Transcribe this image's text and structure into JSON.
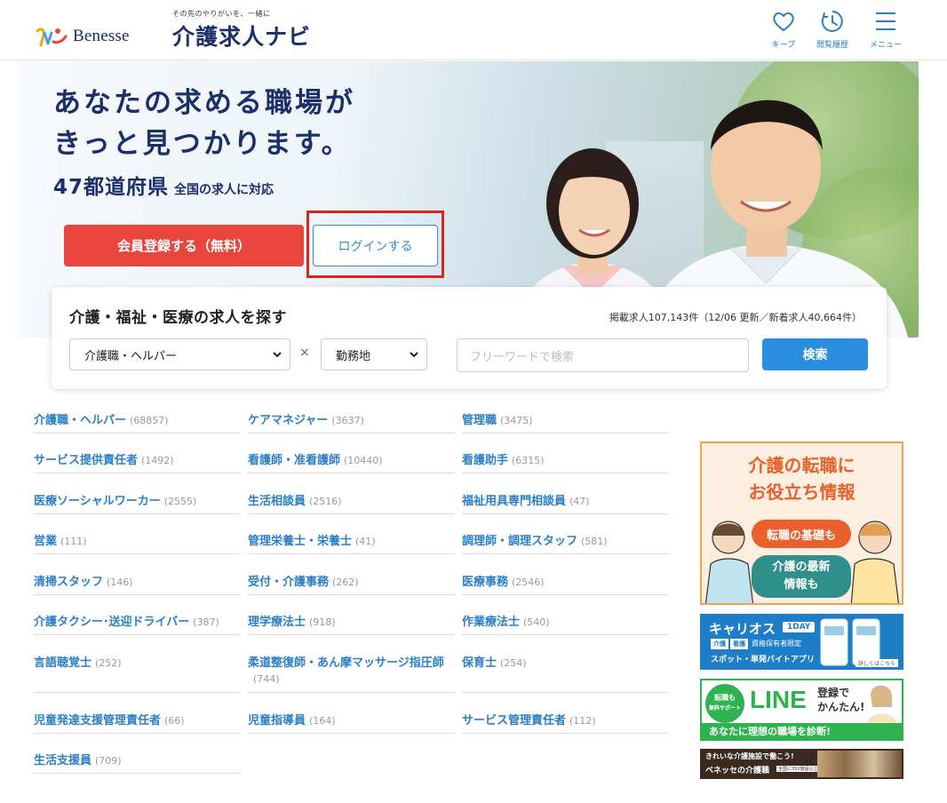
{
  "header": {
    "brand": "Benesse",
    "tagline": "その先のやりがいを、一緒に",
    "site_name": "介護求人ナビ",
    "nav": {
      "keep": "キープ",
      "history": "閲覧履歴",
      "menu": "メニュー"
    }
  },
  "hero": {
    "title_line1": "あなたの求める職場が",
    "title_line2": "きっと見つかります。",
    "prefectures": "47都道府県",
    "coverage": "全国の求人に対応",
    "register_label": "会員登録する（無料）",
    "login_label": "ログインする"
  },
  "search": {
    "title": "介護・福祉・医療の求人を探す",
    "stats": "掲載求人107,143件（12/06 更新／新着求人40,664件）",
    "job_type_selected": "介護職・ヘルパー",
    "times": "×",
    "location_selected": "勤務地",
    "free_placeholder": "フリーワードで検索",
    "button_label": "検索"
  },
  "categories": [
    {
      "label": "介護職・ヘルパー",
      "count": "(68857)"
    },
    {
      "label": "ケアマネジャー",
      "count": "(3637)"
    },
    {
      "label": "管理職",
      "count": "(3475)"
    },
    {
      "label": "サービス提供責任者",
      "count": "(1492)"
    },
    {
      "label": "看護師・准看護師",
      "count": "(10440)"
    },
    {
      "label": "看護助手",
      "count": "(6315)"
    },
    {
      "label": "医療ソーシャルワーカー",
      "count": "(2555)"
    },
    {
      "label": "生活相談員",
      "count": "(2516)"
    },
    {
      "label": "福祉用具専門相談員",
      "count": "(47)"
    },
    {
      "label": "営業",
      "count": "(111)"
    },
    {
      "label": "管理栄養士・栄養士",
      "count": "(41)"
    },
    {
      "label": "調理師・調理スタッフ",
      "count": "(581)"
    },
    {
      "label": "清掃スタッフ",
      "count": "(146)"
    },
    {
      "label": "受付・介護事務",
      "count": "(262)"
    },
    {
      "label": "医療事務",
      "count": "(2546)"
    },
    {
      "label": "介護タクシー･送迎ドライバー",
      "count": "(387)"
    },
    {
      "label": "理学療法士",
      "count": "(918)"
    },
    {
      "label": "作業療法士",
      "count": "(540)"
    },
    {
      "label": "言語聴覚士",
      "count": "(252)"
    },
    {
      "label": "柔道整復師・あん摩マッサージ指圧師",
      "count": "(744)"
    },
    {
      "label": "保育士",
      "count": "(254)"
    },
    {
      "label": "児童発達支援管理責任者",
      "count": "(66)"
    },
    {
      "label": "児童指導員",
      "count": "(164)"
    },
    {
      "label": "サービス管理責任者",
      "count": "(112)"
    },
    {
      "label": "生活支援員",
      "count": "(709)"
    }
  ],
  "banners": {
    "info": {
      "line1": "介護の転職に",
      "line2": "お役立ち情報",
      "bubble1": "転職の基礎も",
      "bubble2a": "介護の最新",
      "bubble2b": "情報も"
    },
    "carios": {
      "name": "キャリオス",
      "tag": "1DAY",
      "chip1": "介護",
      "chip2": "看護",
      "note": "資格保有者限定",
      "sub": "スポット・単発バイトアプリ",
      "more": "詳しくはこちら"
    },
    "line": {
      "badge_top": "転職も",
      "badge_mid": "無料サポート",
      "word": "LINE",
      "reg1": "登録で",
      "reg2": "かんたん!",
      "bottom": "あなたに理想の職場を診断!"
    },
    "facility": {
      "line1": "きれいな介護施設で働こう!",
      "line2": "ベネッセの介護職",
      "badge": "全国に350施設以上"
    }
  },
  "colors": {
    "brand_navy": "#1b2f6b",
    "link_blue": "#2a7fc6",
    "register_red": "#e8453c",
    "highlight_red": "#d9261c",
    "search_blue": "#2a8ee0"
  }
}
